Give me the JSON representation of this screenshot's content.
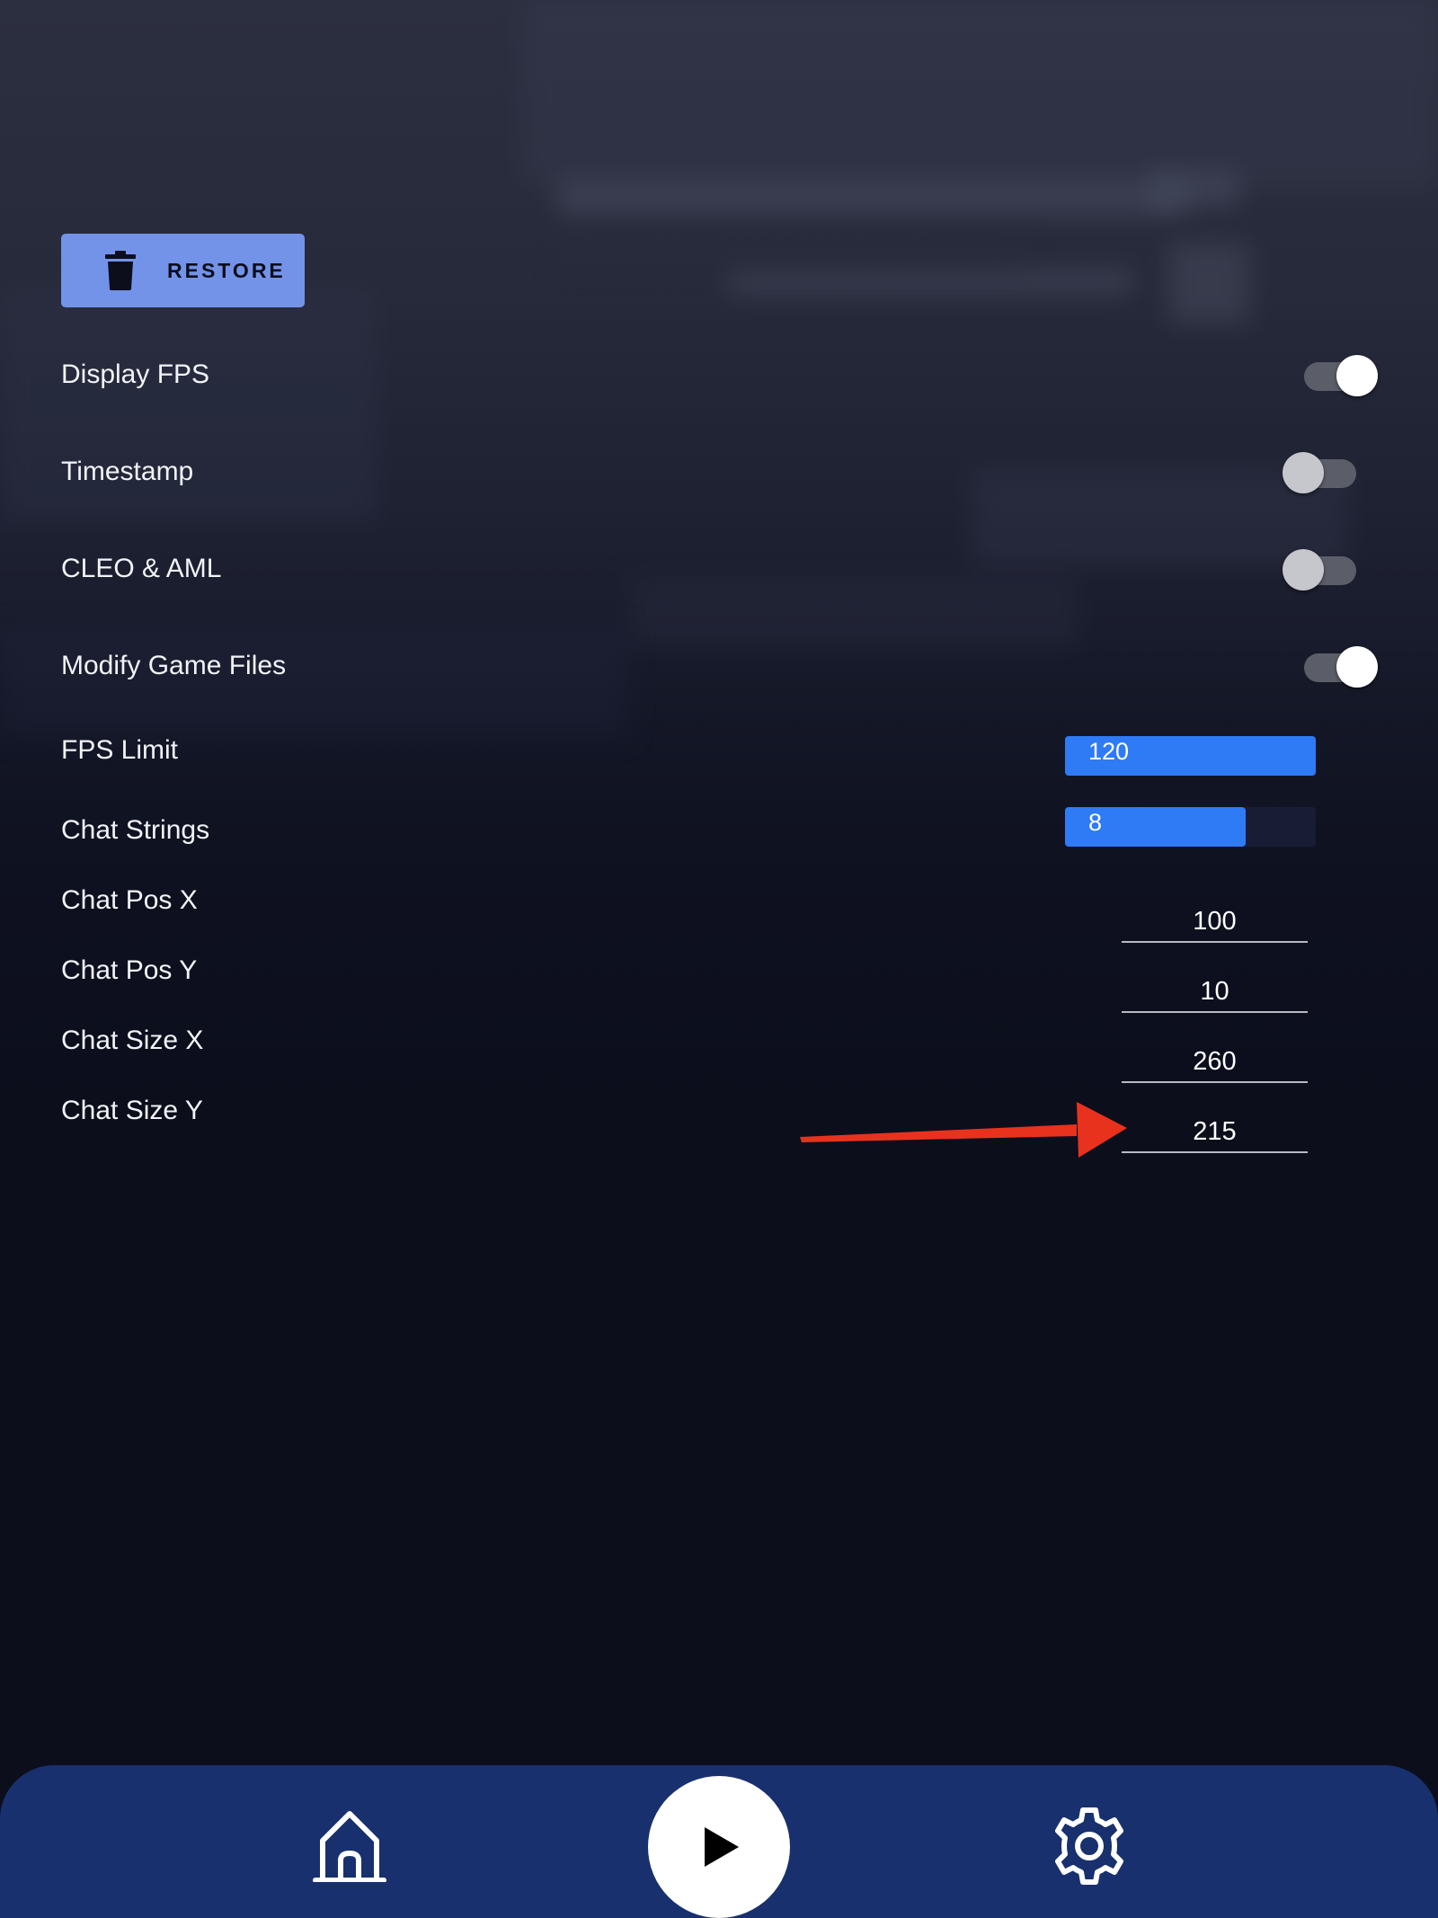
{
  "restore_button": {
    "label": "RESTORE",
    "icon": "trash-icon"
  },
  "toggles": [
    {
      "label": "Display FPS",
      "state": "on"
    },
    {
      "label": "Timestamp",
      "state": "off"
    },
    {
      "label": "CLEO & AML",
      "state": "off"
    },
    {
      "label": "Modify Game Files",
      "state": "on"
    }
  ],
  "sliders": [
    {
      "label": "FPS Limit",
      "value": "120",
      "fill_fraction": 1.0
    },
    {
      "label": "Chat Strings",
      "value": "8",
      "fill_fraction": 0.72
    }
  ],
  "fields": [
    {
      "label": "Chat Pos X",
      "value": "100"
    },
    {
      "label": "Chat Pos Y",
      "value": "10"
    },
    {
      "label": "Chat Size X",
      "value": "260"
    },
    {
      "label": "Chat Size Y",
      "value": "215"
    }
  ],
  "bottom_nav": {
    "items": [
      "home-icon",
      "play-icon",
      "gear-icon"
    ]
  },
  "colors": {
    "accent_button": "#7393e9",
    "slider_fill": "#2f7bf6",
    "nav_bar": "#18306d",
    "annotation_arrow": "#e8321e"
  }
}
